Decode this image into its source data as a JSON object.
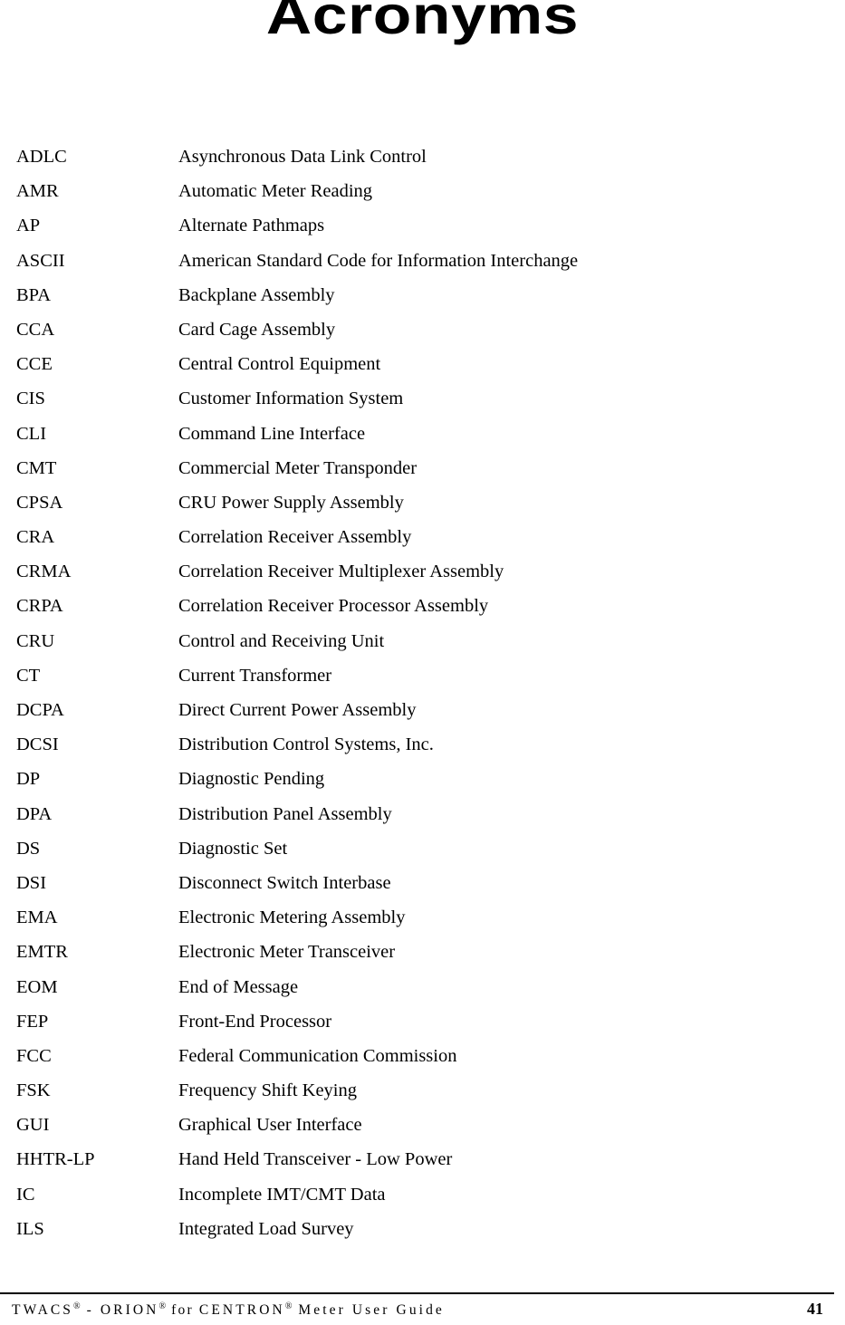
{
  "document": {
    "title": "Acronyms",
    "page_number": "41"
  },
  "acronyms": [
    {
      "term": "ADLC",
      "definition": "Asynchronous Data Link Control"
    },
    {
      "term": "AMR",
      "definition": "Automatic Meter Reading"
    },
    {
      "term": "AP",
      "definition": "Alternate Pathmaps"
    },
    {
      "term": "ASCII",
      "definition": "American Standard Code for Information Interchange"
    },
    {
      "term": "BPA",
      "definition": "Backplane Assembly"
    },
    {
      "term": "CCA",
      "definition": "Card Cage Assembly"
    },
    {
      "term": "CCE",
      "definition": "Central Control Equipment"
    },
    {
      "term": "CIS",
      "definition": "Customer Information System"
    },
    {
      "term": "CLI",
      "definition": "Command Line Interface"
    },
    {
      "term": "CMT",
      "definition": "Commercial Meter Transponder"
    },
    {
      "term": "CPSA",
      "definition": "CRU Power Supply Assembly"
    },
    {
      "term": "CRA",
      "definition": "Correlation Receiver Assembly"
    },
    {
      "term": "CRMA",
      "definition": "Correlation Receiver Multiplexer Assembly"
    },
    {
      "term": "CRPA",
      "definition": "Correlation Receiver Processor Assembly"
    },
    {
      "term": "CRU",
      "definition": "Control and Receiving Unit"
    },
    {
      "term": "CT",
      "definition": "Current Transformer"
    },
    {
      "term": "DCPA",
      "definition": "Direct Current Power Assembly"
    },
    {
      "term": "DCSI",
      "definition": "Distribution Control Systems, Inc."
    },
    {
      "term": "DP",
      "definition": "Diagnostic Pending"
    },
    {
      "term": "DPA",
      "definition": "Distribution Panel Assembly"
    },
    {
      "term": "DS",
      "definition": "Diagnostic Set"
    },
    {
      "term": "DSI",
      "definition": "Disconnect Switch Interbase"
    },
    {
      "term": "EMA",
      "definition": "Electronic Metering Assembly"
    },
    {
      "term": "EMTR",
      "definition": "Electronic Meter Transceiver"
    },
    {
      "term": "EOM",
      "definition": "End of Message"
    },
    {
      "term": "FEP",
      "definition": "Front-End Processor"
    },
    {
      "term": "FCC",
      "definition": "Federal Communication Commission"
    },
    {
      "term": "FSK",
      "definition": "Frequency Shift Keying"
    },
    {
      "term": "GUI",
      "definition": "Graphical User Interface"
    },
    {
      "term": "HHTR-LP",
      "definition": "Hand Held Transceiver - Low Power"
    },
    {
      "term": "IC",
      "definition": "Incomplete IMT/CMT Data"
    },
    {
      "term": "ILS",
      "definition": "Integrated Load Survey"
    }
  ],
  "footer": {
    "segments": [
      {
        "text": "TWACS",
        "type": "caps"
      },
      {
        "text": "®",
        "type": "reg"
      },
      {
        "text": " - ",
        "type": "caps"
      },
      {
        "text": "ORION",
        "type": "caps"
      },
      {
        "text": "®",
        "type": "reg"
      },
      {
        "text": " for ",
        "type": "lower"
      },
      {
        "text": "CENTRON",
        "type": "caps"
      },
      {
        "text": "®",
        "type": "reg"
      },
      {
        "text": " Meter User Guide",
        "type": "caps"
      }
    ],
    "full_text": "TWACS® - ORION® for CENTRON® Meter User Guide"
  }
}
